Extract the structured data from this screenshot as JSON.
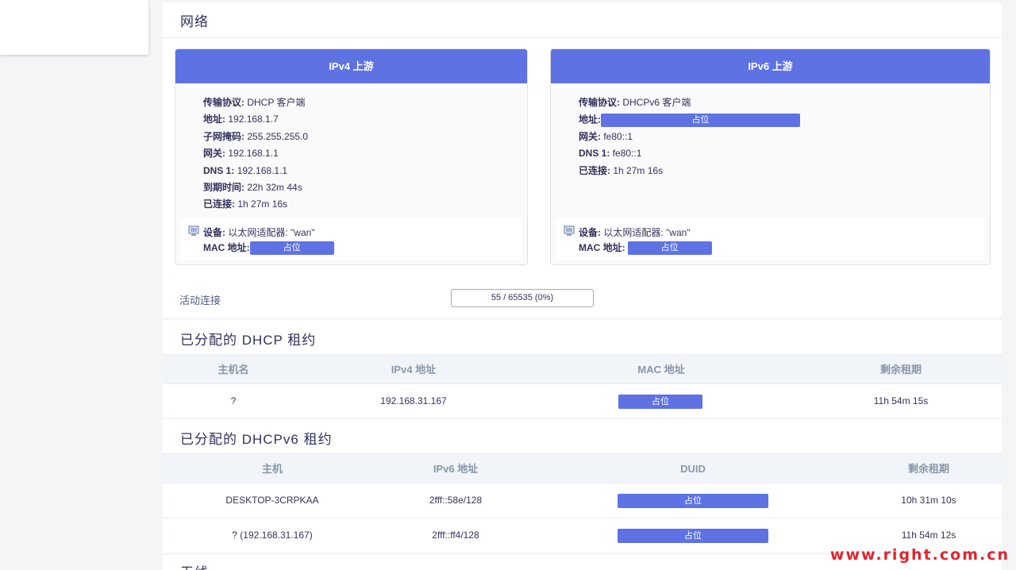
{
  "network": {
    "title": "网络",
    "ipv4": {
      "header": "IPv4 上游",
      "rows": [
        {
          "k": "传输协议:",
          "v": "DHCP 客户端"
        },
        {
          "k": "地址:",
          "v": "192.168.1.7"
        },
        {
          "k": "子网掩码:",
          "v": "255.255.255.0"
        },
        {
          "k": "网关:",
          "v": "192.168.1.1"
        },
        {
          "k": "DNS 1:",
          "v": "192.168.1.1"
        },
        {
          "k": "到期时间:",
          "v": "22h 32m 44s"
        },
        {
          "k": "已连接:",
          "v": "1h 27m 16s"
        }
      ],
      "device_label": "设备:",
      "device_value": "以太网适配器: \"wan\"",
      "mac_label": "MAC 地址:",
      "mac_value": "占位"
    },
    "ipv6": {
      "header": "IPv6 上游",
      "rows": [
        {
          "k": "传输协议:",
          "v": "DHCPv6 客户端"
        },
        {
          "k": "地址:",
          "v": "占位"
        },
        {
          "k": "网关:",
          "v": "fe80::1"
        },
        {
          "k": "DNS 1:",
          "v": "fe80::1"
        },
        {
          "k": "已连接:",
          "v": "1h 27m 16s"
        }
      ],
      "device_label": "设备:",
      "device_value": "以太网适配器: \"wan\"",
      "mac_label": "MAC 地址:",
      "mac_value": "占位"
    },
    "active_connections_label": "活动连接",
    "active_connections_value": "55 / 65535 (0%)",
    "active_connections_fraction": 0.0008
  },
  "dhcp4": {
    "title": "已分配的 DHCP 租约",
    "columns": [
      "主机名",
      "IPv4 地址",
      "MAC 地址",
      "剩余租期"
    ],
    "rows": [
      {
        "host": "?",
        "ip": "192.168.31.167",
        "mac": "占位",
        "lease": "11h 54m 15s"
      }
    ]
  },
  "dhcp6": {
    "title": "已分配的 DHCPv6 租约",
    "columns": [
      "主机",
      "IPv6 地址",
      "DUID",
      "剩余租期"
    ],
    "rows": [
      {
        "host": "DESKTOP-3CRPKAA",
        "ip": "2fff::58e/128",
        "duid": "占位",
        "lease": "10h 31m 10s"
      },
      {
        "host": "? (192.168.31.167)",
        "ip": "2fff::ff4/128",
        "duid": "占位",
        "lease": "11h 54m 12s"
      }
    ]
  },
  "wireless": {
    "title": "无线"
  },
  "watermark": "www.right.com.cn",
  "colors": {
    "accent": "#5e72e4",
    "watermark": "#e0262f"
  }
}
